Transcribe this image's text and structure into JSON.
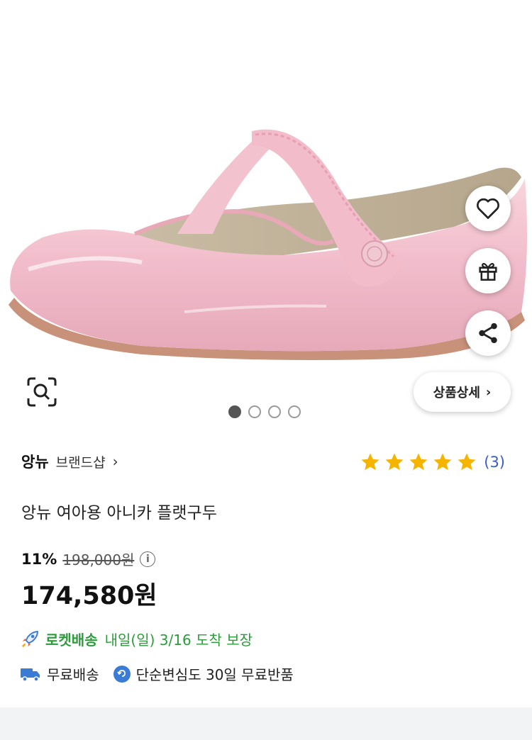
{
  "product": {
    "brand_name": "앙뉴",
    "brand_shop_label": "브랜드샵",
    "title": "앙뉴 여아용 아니카 플랫구두",
    "rating_stars": 5,
    "rating_count": "(3)",
    "discount_rate": "11%",
    "original_price": "198,000원",
    "sale_price": "174,580원"
  },
  "image_gallery": {
    "total_images": 4,
    "active_index": 0,
    "detail_button_label": "상품상세"
  },
  "shipping": {
    "rocket_label": "로켓배송",
    "rocket_arrival": "내일(일) 3/16 도착 보장",
    "free_shipping_label": "무료배송",
    "return_policy_label": "단순변심도 30일 무료반품"
  },
  "icons": {
    "wishlist": "heart-icon",
    "gift": "gift-icon",
    "share": "share-icon",
    "image_search": "lens-search-icon",
    "rocket": "rocket-icon",
    "truck": "truck-icon",
    "return": "return-icon",
    "info": "info-icon"
  },
  "colors": {
    "star": "#f5b400",
    "rating_count": "#3a5cc9",
    "rocket_green": "#2a9d3a",
    "truck_blue": "#3a7bd5",
    "shoe_pink": "#f4c6d0"
  }
}
